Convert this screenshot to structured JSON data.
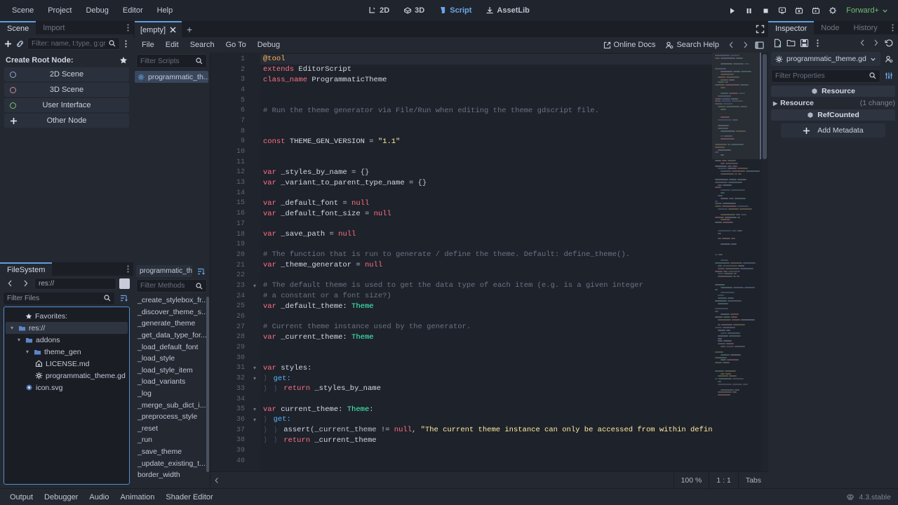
{
  "menubar": {
    "items": [
      "Scene",
      "Project",
      "Debug",
      "Editor",
      "Help"
    ],
    "center_tabs": [
      {
        "label": "2D",
        "icon": "2d-icon",
        "active": false
      },
      {
        "label": "3D",
        "icon": "3d-icon",
        "active": false
      },
      {
        "label": "Script",
        "icon": "script-icon",
        "active": true
      },
      {
        "label": "AssetLib",
        "icon": "assetlib-icon",
        "active": false
      }
    ],
    "right_buttons": [
      "play-icon",
      "pause-icon",
      "stop-icon",
      "play-scene-icon",
      "movie-write-icon",
      "play-custom-icon",
      "remote-debug-icon"
    ],
    "renderer": "Forward+"
  },
  "scene_panel": {
    "tabs": [
      {
        "label": "Scene",
        "active": true
      },
      {
        "label": "Import",
        "active": false
      }
    ],
    "toolbar": [
      "add-node-icon",
      "instance-scene-icon",
      "scene-options-icon"
    ],
    "filter_placeholder": "Filter: name, t:type, g:gr",
    "create_root_label": "Create Root Node:",
    "root_nodes": [
      {
        "label": "2D Scene",
        "icon": "node2d-icon",
        "color": "#8da5cf"
      },
      {
        "label": "3D Scene",
        "icon": "node3d-icon",
        "color": "#cf8b96"
      },
      {
        "label": "User Interface",
        "icon": "control-icon",
        "color": "#79c36e"
      },
      {
        "label": "Other Node",
        "icon": "plus-icon",
        "color": "#e6eaf2"
      }
    ]
  },
  "filesystem_panel": {
    "tabs": [
      {
        "label": "FileSystem",
        "active": true
      }
    ],
    "path": "res://",
    "filter_placeholder": "Filter Files",
    "tree": [
      {
        "label": "Favorites:",
        "depth": 0,
        "icon": "star-icon",
        "twisty": "",
        "selected": false
      },
      {
        "label": "res://",
        "depth": 0,
        "icon": "folder-icon",
        "twisty": "v",
        "selected": true
      },
      {
        "label": "addons",
        "depth": 1,
        "icon": "folder-icon",
        "twisty": "v",
        "selected": false
      },
      {
        "label": "theme_gen",
        "depth": 2,
        "icon": "folder-icon",
        "twisty": "v",
        "selected": false
      },
      {
        "label": "LICENSE.md",
        "depth": 3,
        "icon": "markdown-icon",
        "twisty": "",
        "selected": false
      },
      {
        "label": "programmatic_theme.gd",
        "depth": 3,
        "icon": "gdscript-icon",
        "twisty": "",
        "selected": false
      },
      {
        "label": "icon.svg",
        "depth": 1,
        "icon": "image-icon",
        "twisty": "",
        "selected": false
      }
    ]
  },
  "script_editor": {
    "tabs": [
      {
        "label": "[empty]",
        "active": true
      }
    ],
    "add_tab_label": "+",
    "menus": [
      "File",
      "Edit",
      "Search",
      "Go To",
      "Debug"
    ],
    "right_buttons": [
      {
        "label": "Online Docs",
        "icon": "external-link-icon"
      },
      {
        "label": "Search Help",
        "icon": "help-search-icon"
      }
    ],
    "nav_prev_icon": "chevron-left-icon",
    "nav_next_icon": "chevron-right-icon",
    "panel_toggle_icon": "panel-toggle-icon",
    "expand_icon": "expand-icon",
    "script_list": {
      "filter_placeholder": "Filter Scripts",
      "items": [
        {
          "label": "programmatic_th...",
          "icon": "gdscript-icon",
          "selected": true
        }
      ],
      "selected_name": "programmatic_them",
      "sort_icon": "sort-icon",
      "methods_filter_placeholder": "Filter Methods",
      "methods": [
        "_create_stylebox_fr...",
        "_discover_theme_s...",
        "_generate_theme",
        "_get_data_type_for...",
        "_load_default_font",
        "_load_style",
        "_load_style_item",
        "_load_variants",
        "_log",
        "_merge_sub_dict_i...",
        "_preprocess_style",
        "_reset",
        "_run",
        "_save_theme",
        "_update_existing_t...",
        "border_width"
      ]
    },
    "status": {
      "zoom": "100 %",
      "line_col": "1 : 1",
      "indent": "Tabs",
      "collapse_icon": "chevron-left-icon"
    },
    "code": {
      "first_line": 1,
      "current_line": 1,
      "lines": [
        {
          "n": 1,
          "fold": "",
          "tokens": [
            {
              "t": "@tool",
              "c": "ann"
            }
          ]
        },
        {
          "n": 2,
          "fold": "",
          "tokens": [
            {
              "t": "extends ",
              "c": "kw"
            },
            {
              "t": "EditorScript",
              "c": "id"
            }
          ]
        },
        {
          "n": 3,
          "fold": "",
          "tokens": [
            {
              "t": "class_name ",
              "c": "kw"
            },
            {
              "t": "ProgrammaticTheme",
              "c": "id"
            }
          ]
        },
        {
          "n": 4,
          "fold": "",
          "tokens": []
        },
        {
          "n": 5,
          "fold": "",
          "tokens": []
        },
        {
          "n": 6,
          "fold": "",
          "tokens": [
            {
              "t": "# Run the theme generator via File/Run when editing the theme gdscript file.",
              "c": "com"
            }
          ]
        },
        {
          "n": 7,
          "fold": "",
          "tokens": []
        },
        {
          "n": 8,
          "fold": "",
          "tokens": []
        },
        {
          "n": 9,
          "fold": "",
          "tokens": [
            {
              "t": "const ",
              "c": "kw"
            },
            {
              "t": "THEME_GEN_VERSION ",
              "c": "id"
            },
            {
              "t": "= ",
              "c": "punc"
            },
            {
              "t": "\"1.1\"",
              "c": "str"
            }
          ]
        },
        {
          "n": 10,
          "fold": "",
          "tokens": []
        },
        {
          "n": 11,
          "fold": "",
          "tokens": []
        },
        {
          "n": 12,
          "fold": "",
          "tokens": [
            {
              "t": "var ",
              "c": "kw"
            },
            {
              "t": "_styles_by_name ",
              "c": "id"
            },
            {
              "t": "= {}",
              "c": "punc"
            }
          ]
        },
        {
          "n": 13,
          "fold": "",
          "tokens": [
            {
              "t": "var ",
              "c": "kw"
            },
            {
              "t": "_variant_to_parent_type_name ",
              "c": "id"
            },
            {
              "t": "= {}",
              "c": "punc"
            }
          ]
        },
        {
          "n": 14,
          "fold": "",
          "tokens": []
        },
        {
          "n": 15,
          "fold": "",
          "tokens": [
            {
              "t": "var ",
              "c": "kw"
            },
            {
              "t": "_default_font ",
              "c": "id"
            },
            {
              "t": "= ",
              "c": "punc"
            },
            {
              "t": "null",
              "c": "kw"
            }
          ]
        },
        {
          "n": 16,
          "fold": "",
          "tokens": [
            {
              "t": "var ",
              "c": "kw"
            },
            {
              "t": "_default_font_size ",
              "c": "id"
            },
            {
              "t": "= ",
              "c": "punc"
            },
            {
              "t": "null",
              "c": "kw"
            }
          ]
        },
        {
          "n": 17,
          "fold": "",
          "tokens": []
        },
        {
          "n": 18,
          "fold": "",
          "tokens": [
            {
              "t": "var ",
              "c": "kw"
            },
            {
              "t": "_save_path ",
              "c": "id"
            },
            {
              "t": "= ",
              "c": "punc"
            },
            {
              "t": "null",
              "c": "kw"
            }
          ]
        },
        {
          "n": 19,
          "fold": "",
          "tokens": []
        },
        {
          "n": 20,
          "fold": "",
          "tokens": [
            {
              "t": "# The function that is run to generate / define the theme. Default: define_theme().",
              "c": "com"
            }
          ]
        },
        {
          "n": 21,
          "fold": "",
          "tokens": [
            {
              "t": "var ",
              "c": "kw"
            },
            {
              "t": "_theme_generator ",
              "c": "id"
            },
            {
              "t": "= ",
              "c": "punc"
            },
            {
              "t": "null",
              "c": "kw"
            }
          ]
        },
        {
          "n": 22,
          "fold": "",
          "tokens": []
        },
        {
          "n": 23,
          "fold": "v",
          "tokens": [
            {
              "t": "# The default theme is used to get the data type of each item (e.g. is a given integer",
              "c": "com"
            }
          ]
        },
        {
          "n": 24,
          "fold": "",
          "tokens": [
            {
              "t": "# a constant or a font size?)",
              "c": "com"
            }
          ]
        },
        {
          "n": 25,
          "fold": "",
          "tokens": [
            {
              "t": "var ",
              "c": "kw"
            },
            {
              "t": "_default_theme: ",
              "c": "id"
            },
            {
              "t": "Theme",
              "c": "type"
            }
          ]
        },
        {
          "n": 26,
          "fold": "",
          "tokens": []
        },
        {
          "n": 27,
          "fold": "",
          "tokens": [
            {
              "t": "# Current theme instance used by the generator.",
              "c": "com"
            }
          ]
        },
        {
          "n": 28,
          "fold": "",
          "tokens": [
            {
              "t": "var ",
              "c": "kw"
            },
            {
              "t": "_current_theme: ",
              "c": "id"
            },
            {
              "t": "Theme",
              "c": "type"
            }
          ]
        },
        {
          "n": 29,
          "fold": "",
          "tokens": []
        },
        {
          "n": 30,
          "fold": "",
          "tokens": []
        },
        {
          "n": 31,
          "fold": "v",
          "tokens": [
            {
              "t": "var ",
              "c": "kw"
            },
            {
              "t": "styles:",
              "c": "id"
            }
          ]
        },
        {
          "n": 32,
          "fold": "v",
          "indent": 1,
          "tokens": [
            {
              "t": "get:",
              "c": "fn"
            }
          ]
        },
        {
          "n": 33,
          "fold": "",
          "indent": 2,
          "tokens": [
            {
              "t": "return ",
              "c": "kw"
            },
            {
              "t": "_styles_by_name",
              "c": "id"
            }
          ]
        },
        {
          "n": 34,
          "fold": "",
          "tokens": []
        },
        {
          "n": 35,
          "fold": "v",
          "tokens": [
            {
              "t": "var ",
              "c": "kw"
            },
            {
              "t": "current_theme: ",
              "c": "id"
            },
            {
              "t": "Theme",
              "c": "type"
            },
            {
              "t": ":",
              "c": "punc"
            }
          ]
        },
        {
          "n": 36,
          "fold": "v",
          "indent": 1,
          "tokens": [
            {
              "t": "get:",
              "c": "fn"
            }
          ]
        },
        {
          "n": 37,
          "fold": "",
          "indent": 2,
          "tokens": [
            {
              "t": "assert",
              "c": "id"
            },
            {
              "t": "(_current_theme != ",
              "c": "punc"
            },
            {
              "t": "null",
              "c": "kw"
            },
            {
              "t": ", ",
              "c": "punc"
            },
            {
              "t": "\"The current theme instance can only be accessed from within define_theme().\"",
              "c": "str"
            },
            {
              "t": ")",
              "c": "punc"
            }
          ]
        },
        {
          "n": 38,
          "fold": "",
          "indent": 2,
          "tokens": [
            {
              "t": "return ",
              "c": "kw"
            },
            {
              "t": "_current_theme",
              "c": "id"
            }
          ]
        },
        {
          "n": 39,
          "fold": "",
          "tokens": []
        },
        {
          "n": 40,
          "fold": "",
          "tokens": []
        }
      ]
    }
  },
  "inspector": {
    "tabs": [
      {
        "label": "Inspector",
        "active": true
      },
      {
        "label": "Node",
        "active": false
      },
      {
        "label": "History",
        "active": false
      }
    ],
    "tools": [
      "new-resource-icon",
      "load-resource-icon",
      "save-resource-icon",
      "resource-menu-icon",
      "history-prev-icon",
      "history-next-icon",
      "history-revert-icon"
    ],
    "resource_name": "programmatic_theme.gd",
    "resource_icon": "gdscript-icon",
    "open_docs_icon": "open-docs-icon",
    "filter_placeholder": "Filter Properties",
    "filter_options_icon": "property-options-icon",
    "rows": [
      {
        "type": "category",
        "label": "Resource",
        "icon": "resource-icon"
      },
      {
        "type": "property",
        "label": "Resource",
        "change": "(1 change)",
        "twisty": "chevron-right-icon"
      },
      {
        "type": "category",
        "label": "RefCounted",
        "icon": "resource-icon"
      }
    ],
    "add_metadata_label": "Add Metadata",
    "add_metadata_icon": "plus-icon"
  },
  "bottom_bar": {
    "items": [
      "Output",
      "Debugger",
      "Audio",
      "Animation",
      "Shader Editor"
    ],
    "version": "4.3.stable",
    "version_icon": "godot-icon"
  }
}
